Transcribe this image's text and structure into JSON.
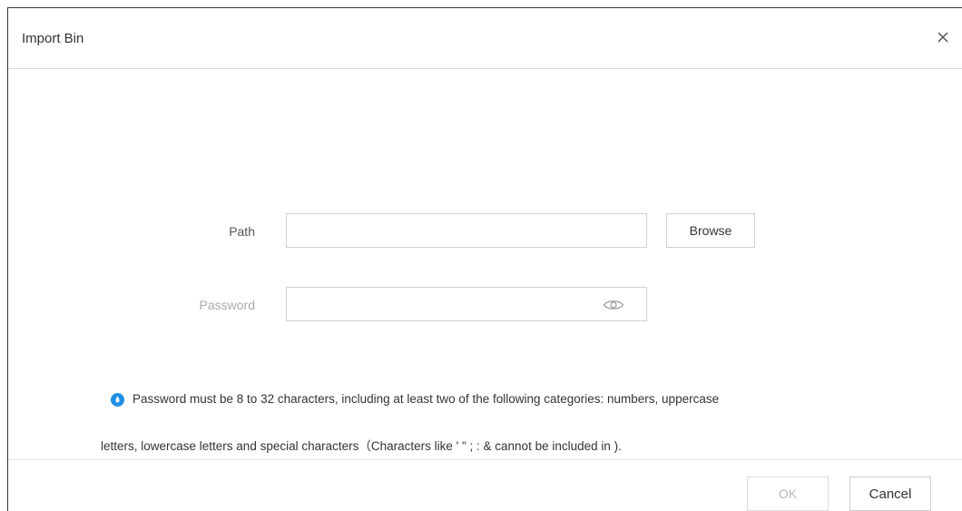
{
  "dialog": {
    "title": "Import Bin",
    "close_icon": "close-icon"
  },
  "form": {
    "path_label": "Path",
    "path_value": "",
    "browse_label": "Browse",
    "password_label": "Password",
    "password_value": "",
    "password_icon": "eye-icon"
  },
  "hint": {
    "icon": "info-icon",
    "line1": "Password must be 8 to 32 characters, including at least two of the following categories: numbers, uppercase",
    "line2": "letters, lowercase letters and special characters（Characters like ' \" ; : & cannot be included in )."
  },
  "footer": {
    "ok_label": "OK",
    "cancel_label": "Cancel"
  },
  "colors": {
    "accent": "#1f8fe5",
    "border": "#cfcfcf",
    "disabled_text": "#b8b8b8"
  }
}
